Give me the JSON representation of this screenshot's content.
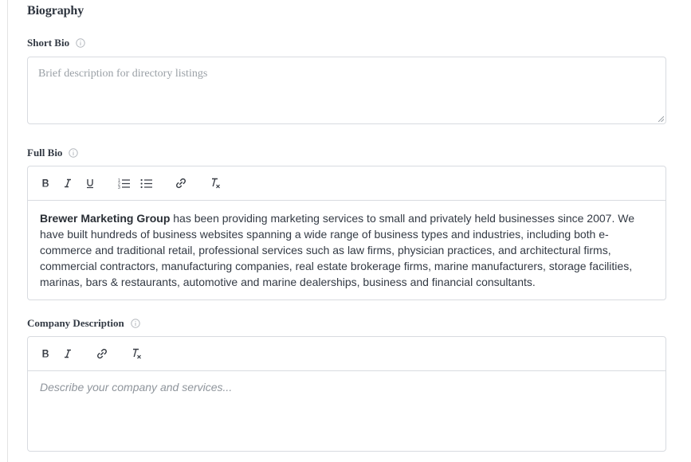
{
  "section": {
    "title": "Biography"
  },
  "short_bio": {
    "label": "Short Bio",
    "info_icon": "info-circle-icon",
    "placeholder": "Brief description for directory listings",
    "value": ""
  },
  "full_bio": {
    "label": "Full Bio",
    "info_icon": "info-circle-icon",
    "toolbar": [
      "bold-icon",
      "italic-icon",
      "underline-icon",
      "ordered-list-icon",
      "bullet-list-icon",
      "link-icon",
      "clear-format-icon"
    ],
    "content_bold": "Brewer Marketing Group",
    "content_rest": " has been providing marketing services to small and privately held businesses since 2007. We have built hundreds of business websites spanning a wide range of business types and industries, including both e-commerce and traditional retail, professional services such as law firms, physician practices, and architectural firms, commercial contractors, manufacturing companies, real estate brokerage firms, marine manufacturers, storage facilities, marinas, bars & restaurants, automotive and marine dealerships, business and financial consultants."
  },
  "company_description": {
    "label": "Company Description",
    "info_icon": "info-circle-icon",
    "toolbar": [
      "bold-icon",
      "italic-icon",
      "link-icon",
      "clear-format-icon"
    ],
    "placeholder": "Describe your company and services..."
  }
}
